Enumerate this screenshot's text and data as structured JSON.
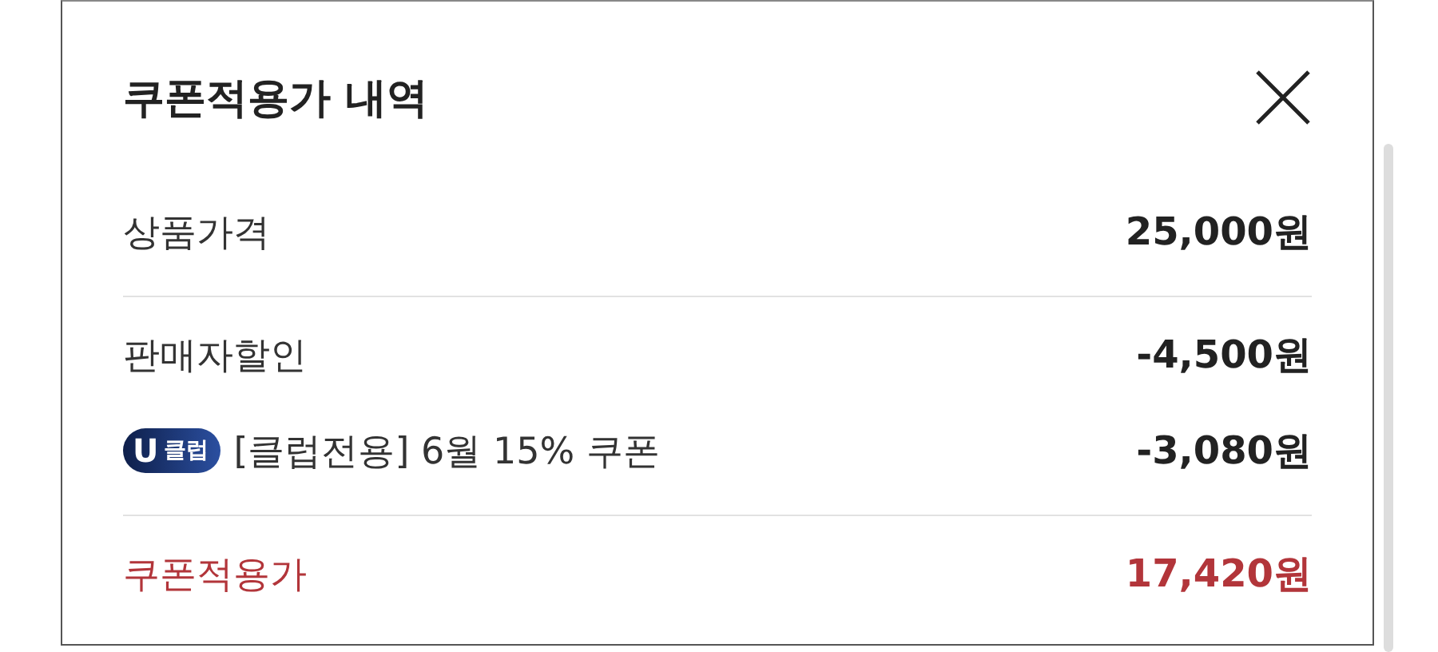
{
  "dialog": {
    "title": "쿠폰적용가 내역"
  },
  "sections": [
    {
      "rows": [
        {
          "kind": "plain",
          "label": "상품가격",
          "amount": "25,000원"
        }
      ]
    },
    {
      "rows": [
        {
          "kind": "plain",
          "label": "판매자할인",
          "amount": "-4,500원"
        },
        {
          "kind": "coupon",
          "badge": {
            "letter": "U",
            "text": "클럽"
          },
          "label": "[클럽전용] 6월 15% 쿠폰",
          "amount": "-3,080원"
        }
      ]
    },
    {
      "rows": [
        {
          "kind": "total",
          "label": "쿠폰적용가",
          "amount": "17,420원"
        }
      ]
    }
  ]
}
